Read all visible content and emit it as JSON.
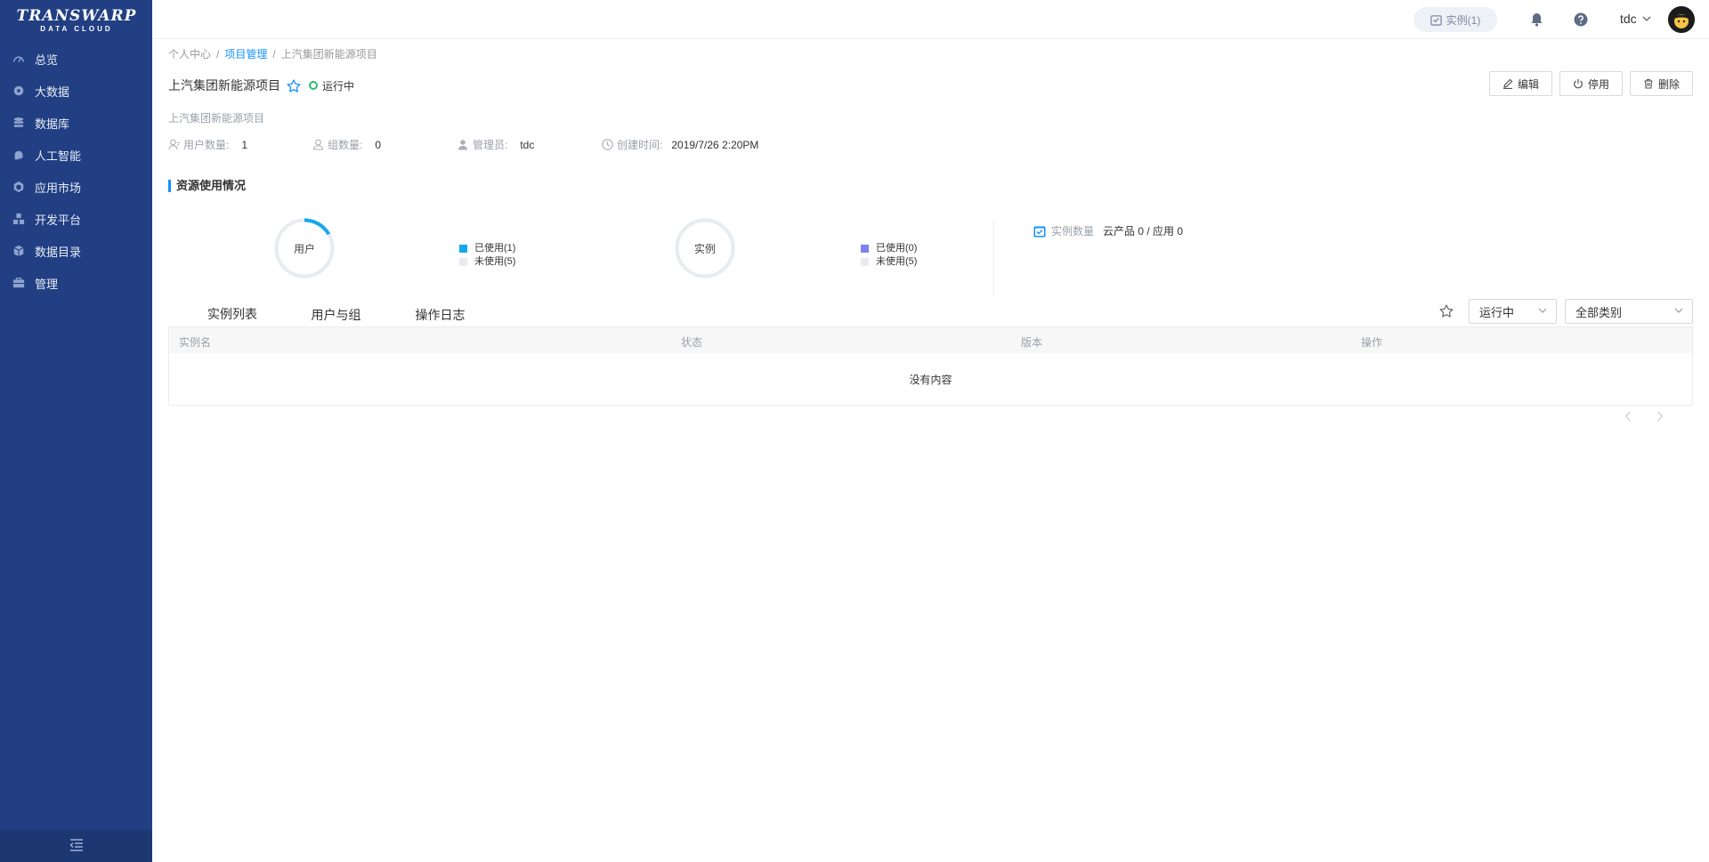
{
  "brand": {
    "name": "TRANSWARP",
    "sub": "DATA CLOUD"
  },
  "sidebar": {
    "items": [
      {
        "label": "总览",
        "icon": "dashboard-icon"
      },
      {
        "label": "大数据",
        "icon": "big-data-icon"
      },
      {
        "label": "数据库",
        "icon": "database-icon"
      },
      {
        "label": "人工智能",
        "icon": "ai-brain-icon"
      },
      {
        "label": "应用市场",
        "icon": "app-market-icon"
      },
      {
        "label": "开发平台",
        "icon": "dev-platform-icon"
      },
      {
        "label": "数据目录",
        "icon": "data-catalog-icon"
      },
      {
        "label": "管理",
        "icon": "management-icon"
      }
    ]
  },
  "header": {
    "instance_pill": "实例(1)",
    "user": "tdc"
  },
  "breadcrumb": {
    "items": [
      "个人中心",
      "项目管理",
      "上汽集团新能源项目"
    ],
    "separator": "/"
  },
  "project": {
    "title": "上汽集团新能源项目",
    "status": "运行中",
    "description": "上汽集团新能源项目",
    "meta": [
      {
        "label": "用户数量:",
        "value": "1",
        "icon": "user-count-icon"
      },
      {
        "label": "组数量:",
        "value": "0",
        "icon": "group-icon"
      },
      {
        "label": "管理员:",
        "value": "tdc",
        "icon": "admin-icon"
      },
      {
        "label": "创建时间:",
        "value": "2019/7/26 2:20PM",
        "icon": "clock-icon"
      }
    ]
  },
  "actions": {
    "edit": "编辑",
    "disable": "停用",
    "delete": "删除"
  },
  "resources": {
    "title": "资源使用情况",
    "user_chart": {
      "label": "用户",
      "used_label": "已使用(1)",
      "unused_label": "未使用(5)",
      "used": 1,
      "unused": 5,
      "used_color": "#13a8f0",
      "unused_color": "#e8ebef"
    },
    "instance_chart": {
      "label": "实例",
      "used_label": "已使用(0)",
      "unused_label": "未使用(5)",
      "used": 0,
      "unused": 5,
      "used_color": "#7b83f2",
      "unused_color": "#e8ebef"
    },
    "instance_count": {
      "label": "实例数量",
      "value": "云产品 0 / 应用 0"
    }
  },
  "tabs": [
    {
      "label": "实例列表",
      "active": true
    },
    {
      "label": "用户与组",
      "active": false
    },
    {
      "label": "操作日志",
      "active": false
    }
  ],
  "filters": {
    "status": "运行中",
    "category": "全部类别"
  },
  "table": {
    "columns": [
      "实例名",
      "状态",
      "版本",
      "操作"
    ],
    "empty_text": "没有内容"
  }
}
